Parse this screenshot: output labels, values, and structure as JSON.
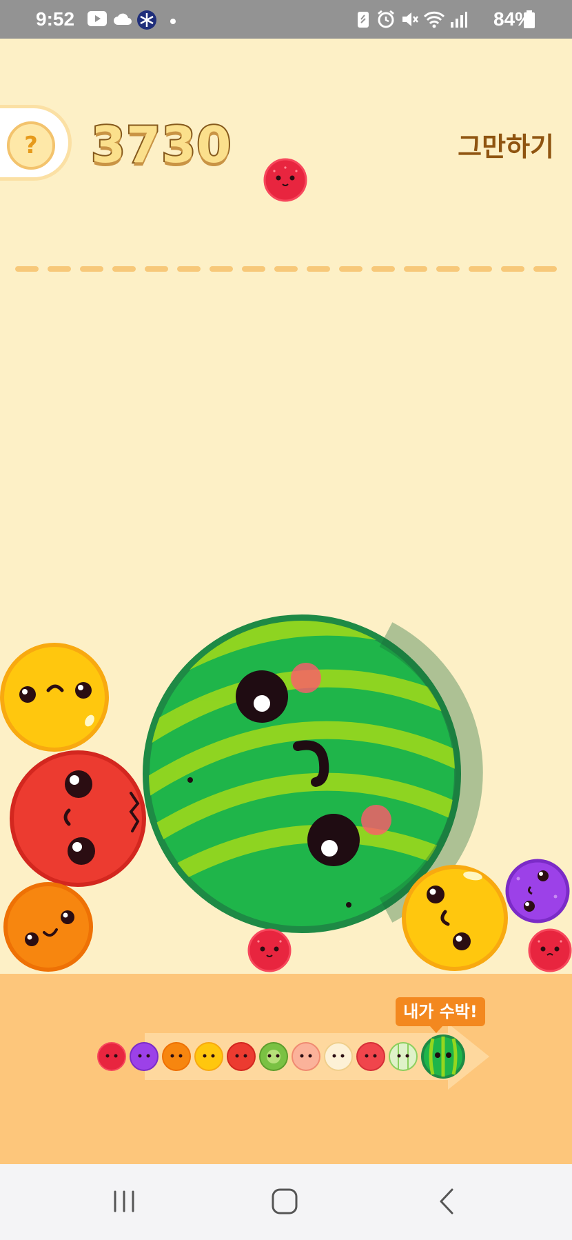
{
  "status_bar": {
    "time": "9:52",
    "battery": "84%",
    "left_icons": [
      "youtube-icon",
      "cloud-icon",
      "snowflake-app-icon",
      "dot-icon"
    ],
    "right_icons": [
      "battery-saver-icon",
      "alarm-icon",
      "mute-icon",
      "wifi-icon",
      "signal-icon",
      "battery-icon"
    ]
  },
  "game": {
    "score": "3730",
    "help_label": "?",
    "quit_label": "그만하기",
    "next_fruit": "cherry",
    "evolution_badge": "내가 수박!",
    "evolution_order": [
      "cherry",
      "grape",
      "orange-small",
      "lemon",
      "apple-red",
      "kiwi",
      "peach",
      "pear",
      "apple",
      "melon",
      "watermelon"
    ],
    "colors": {
      "background": "#fdf0c6",
      "ground": "#fdc67b",
      "score_fill": "#fbe08c",
      "score_stroke": "#85591c",
      "quit_text": "#8f5410",
      "badge": "#f3881f",
      "dashed_line": "#f7c879"
    }
  },
  "nav_bar": {
    "buttons": [
      "recent-apps-icon",
      "home-icon",
      "back-icon"
    ]
  }
}
